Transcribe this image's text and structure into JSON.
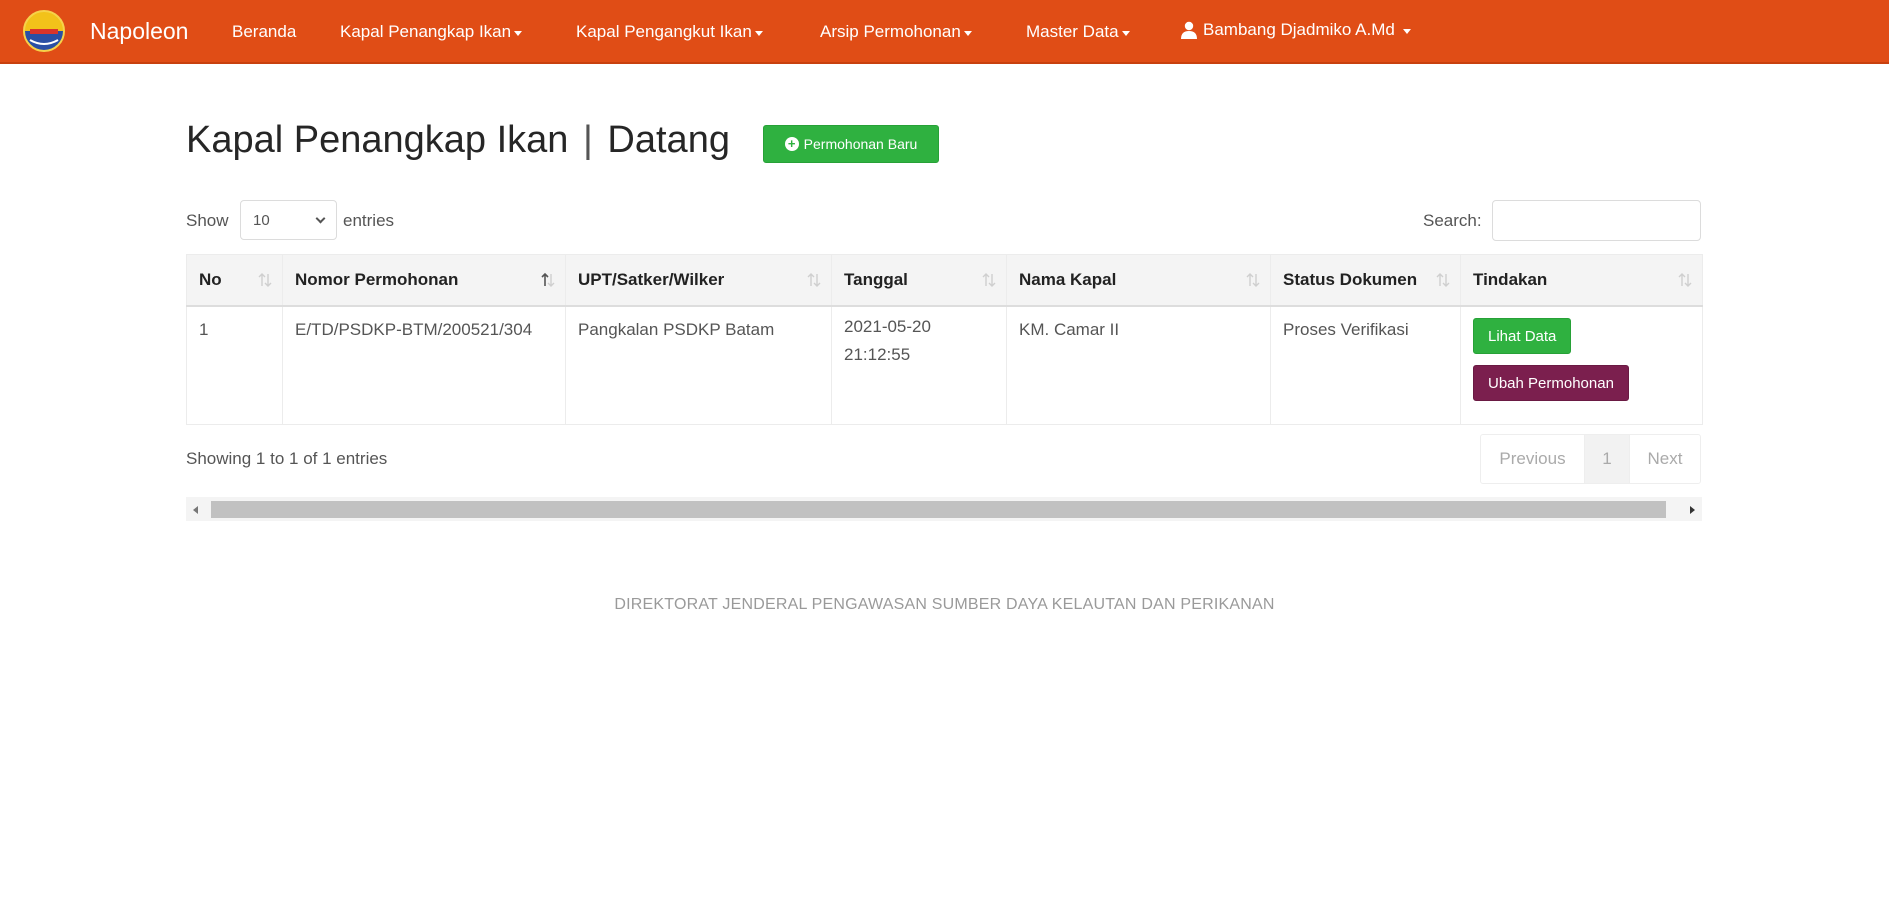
{
  "navbar": {
    "brand": "Napoleon",
    "items": [
      {
        "label": "Beranda",
        "dropdown": false
      },
      {
        "label": "Kapal Penangkap Ikan",
        "dropdown": true
      },
      {
        "label": "Kapal Pengangkut Ikan",
        "dropdown": true
      },
      {
        "label": "Arsip Permohonan",
        "dropdown": true
      },
      {
        "label": "Master Data",
        "dropdown": true
      }
    ],
    "user": "Bambang Djadmiko A.Md",
    "colors": {
      "bar": "#e04d16",
      "text": "#ffffff"
    }
  },
  "page": {
    "title_main": "Kapal Penangkap Ikan",
    "title_separator": "|",
    "title_sub": "Datang",
    "new_button_label": "Permohonan Baru"
  },
  "table_controls": {
    "show_label": "Show",
    "entries_label": "entries",
    "length_value": "10",
    "search_label": "Search:",
    "search_value": ""
  },
  "table": {
    "headers": [
      "No",
      "Nomor Permohonan",
      "UPT/Satker/Wilker",
      "Tanggal",
      "Nama Kapal",
      "Status Dokumen",
      "Tindakan"
    ],
    "rows": [
      {
        "no": "1",
        "nomor": "E/TD/PSDKP-BTM/200521/304",
        "upt": "Pangkalan PSDKP Batam",
        "tanggal_date": "2021-05-20",
        "tanggal_time": "21:12:55",
        "nama_kapal": "KM. Camar II",
        "status": "Proses Verifikasi",
        "action_view": "Lihat Data",
        "action_edit": "Ubah Permohonan"
      }
    ]
  },
  "info_text": "Showing 1 to 1 of 1 entries",
  "pagination": {
    "previous": "Previous",
    "current": "1",
    "next": "Next"
  },
  "footer": "DIREKTORAT JENDERAL PENGAWASAN SUMBER DAYA KELAUTAN DAN PERIKANAN",
  "colors": {
    "success": "#2fb140",
    "edit": "#7b1f4e"
  }
}
